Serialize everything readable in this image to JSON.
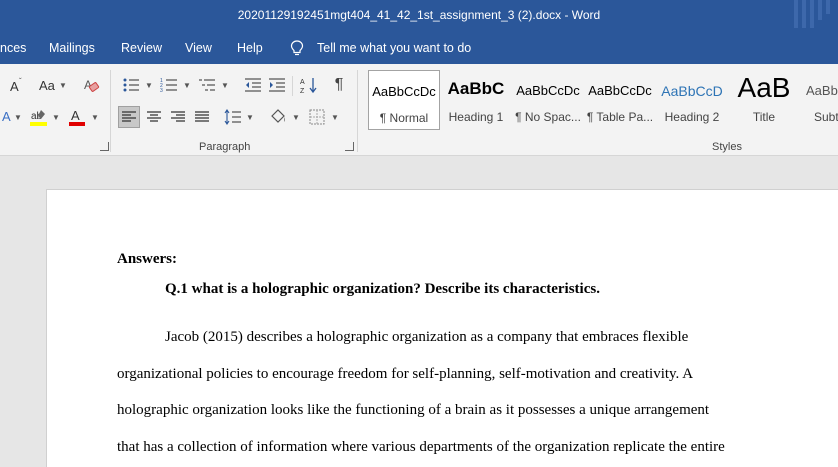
{
  "window": {
    "title": "20201129192451mgt404_41_42_1st_assignment_3 (2).docx  -  Word"
  },
  "menu": {
    "items": [
      "nces",
      "Mailings",
      "Review",
      "View",
      "Help"
    ],
    "tell_me": "Tell me what you want to do"
  },
  "ribbon": {
    "font_group": {
      "shrink_font": "A",
      "change_case": "Aa"
    },
    "paragraph_group": {
      "label": "Paragraph"
    },
    "styles_group": {
      "label": "Styles",
      "items": [
        {
          "sample": "AaBbCcDc",
          "name": "¶ Normal",
          "selected": true
        },
        {
          "sample": "AaBbC",
          "name": "Heading 1",
          "selected": false
        },
        {
          "sample": "AaBbCcDc",
          "name": "¶ No Spac...",
          "selected": false
        },
        {
          "sample": "AaBbCcDc",
          "name": "¶ Table Pa...",
          "selected": false
        },
        {
          "sample": "AaBbCcD",
          "name": "Heading 2",
          "selected": false
        },
        {
          "sample": "AaB",
          "name": "Title",
          "selected": false
        },
        {
          "sample": "AaBb",
          "name": "Subt",
          "selected": false
        }
      ]
    }
  },
  "document": {
    "answers_heading": "Answers:",
    "question": "Q.1 what is a holographic organization? Describe its characteristics.",
    "lines": [
      "Jacob (2015) describes a holographic organization as a company that embraces flexible",
      "organizational policies to encourage freedom for self-planning, self-motivation and creativity. A",
      "holographic organization looks like the functioning of a brain as it possesses a unique arrangement",
      "that has a collection of information where various departments of the organization replicate the entire"
    ]
  },
  "colors": {
    "accent": "#2b579a",
    "ribbon_bg": "#f3f3f3",
    "canvas_bg": "#e6e6e6",
    "highlight_yellow": "#ffff00",
    "font_color_red": "#e00000"
  },
  "icons": [
    "lightbulb-icon",
    "bullets-icon",
    "numbering-icon",
    "multilevel-list-icon",
    "decrease-indent-icon",
    "increase-indent-icon",
    "sort-icon",
    "pilcrow-icon",
    "clear-formatting-icon",
    "highlighter-icon",
    "font-color-icon",
    "align-left-icon",
    "center-icon",
    "align-right-icon",
    "justify-icon",
    "line-spacing-icon",
    "shading-icon",
    "borders-icon"
  ]
}
